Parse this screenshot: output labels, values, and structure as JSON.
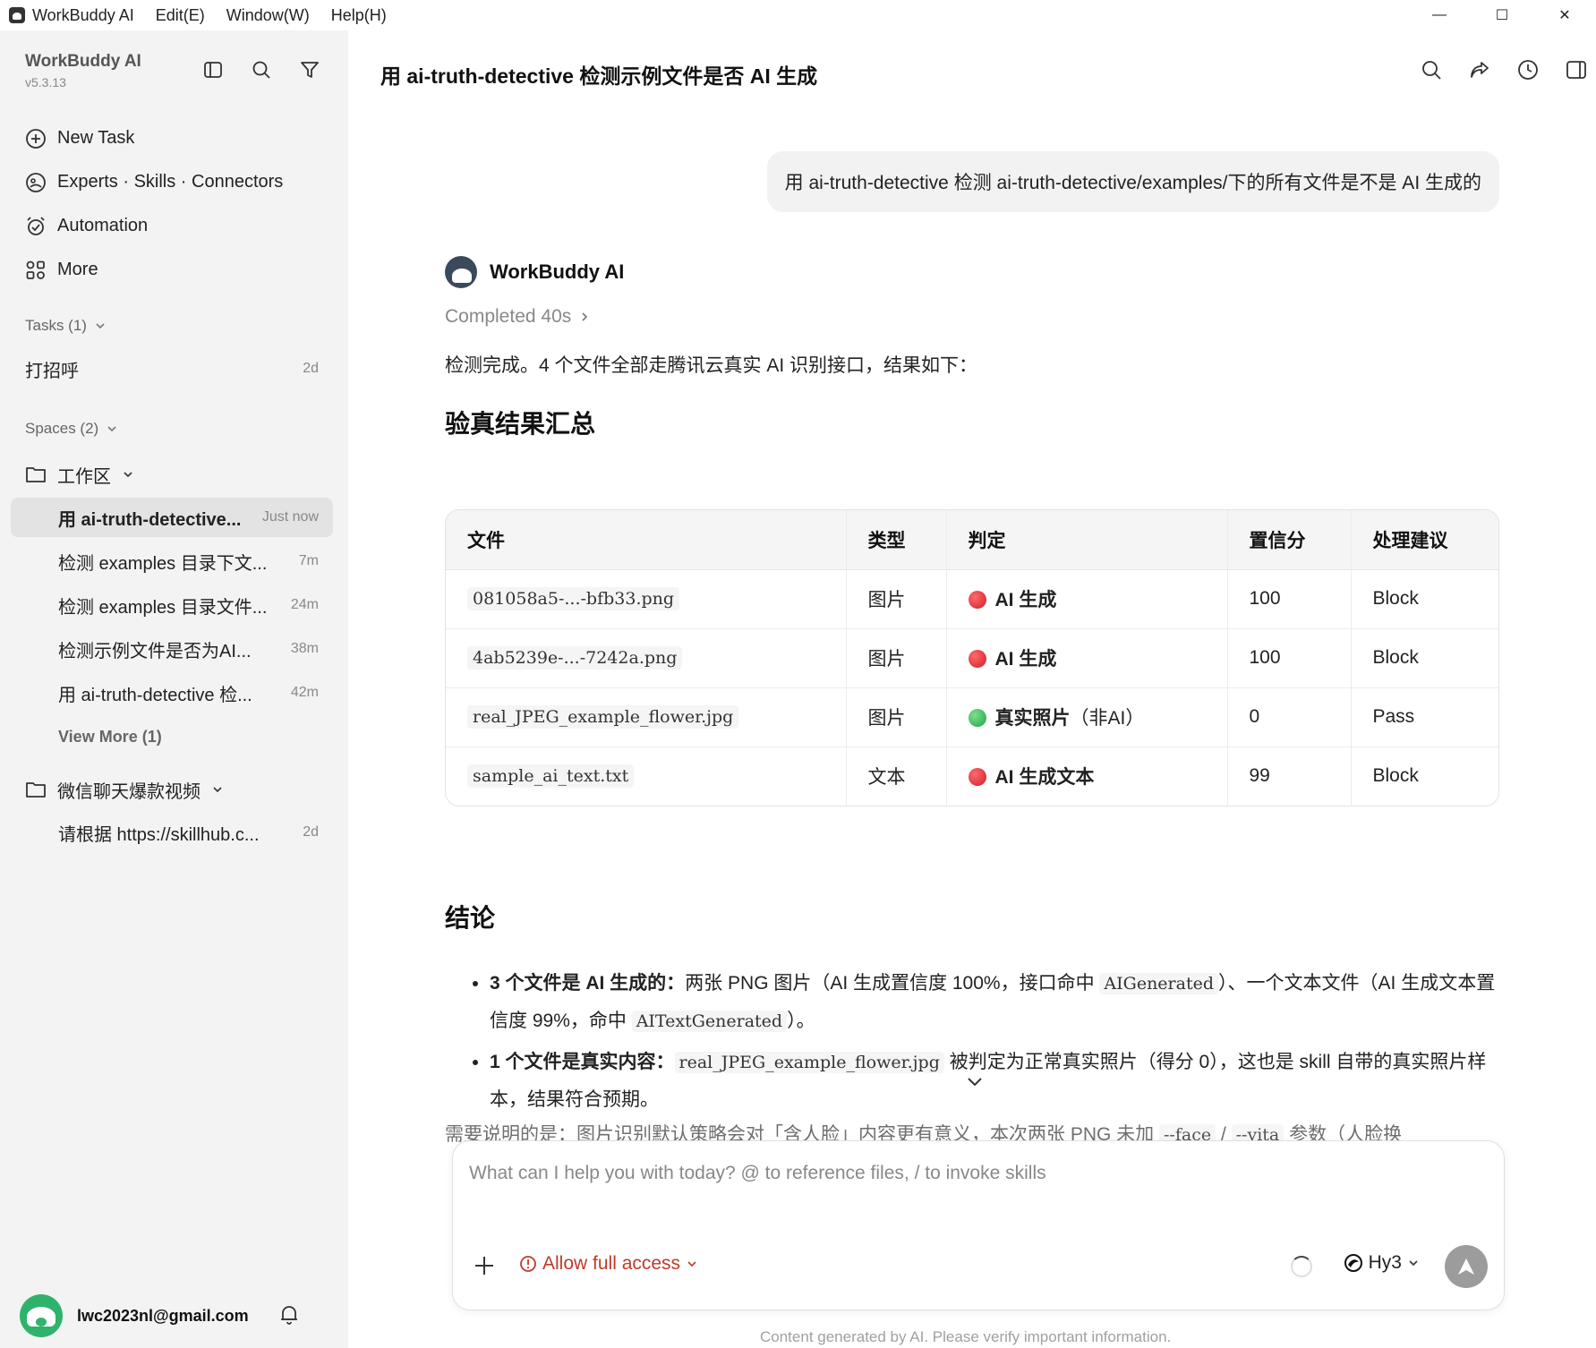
{
  "titlebar": {
    "app_name": "WorkBuddy AI",
    "menus": [
      "Edit(E)",
      "Window(W)",
      "Help(H)"
    ],
    "minimize": "—",
    "maximize": "☐",
    "close": "✕"
  },
  "sidebar": {
    "brand": "WorkBuddy AI",
    "version": "v5.3.13",
    "nav": [
      {
        "label": "New Task",
        "icon": "plus-circle-icon"
      },
      {
        "label": "Experts · Skills · Connectors",
        "icon": "experts-icon"
      },
      {
        "label": "Automation",
        "icon": "alarm-icon"
      },
      {
        "label": "More",
        "icon": "grid-icon"
      }
    ],
    "tasks_label": "Tasks (1)",
    "tasks": [
      {
        "title": "打招呼",
        "time": "2d"
      }
    ],
    "spaces_label": "Spaces (2)",
    "workspace1": {
      "name": "工作区",
      "items": [
        {
          "title": "用 ai-truth-detective...",
          "time": "Just now"
        },
        {
          "title": "检测 examples 目录下文...",
          "time": "7m"
        },
        {
          "title": "检测 examples 目录文件...",
          "time": "24m"
        },
        {
          "title": "检测示例文件是否为AI...",
          "time": "38m"
        },
        {
          "title": "用 ai-truth-detective 检...",
          "time": "42m"
        }
      ],
      "view_more": "View More (1)"
    },
    "workspace2": {
      "name": "微信聊天爆款视频",
      "items": [
        {
          "title": "请根据 https://skillhub.c...",
          "time": "2d"
        }
      ]
    },
    "user_email": "lwc2023nl@gmail.com"
  },
  "main": {
    "title": "用 ai-truth-detective 检测示例文件是否 AI 生成",
    "user_message": "用 ai-truth-detective 检测 ai-truth-detective/examples/下的所有文件是不是 AI 生成的",
    "bot_name": "WorkBuddy AI",
    "completed": "Completed 40s",
    "intro": "检测完成。4 个文件全部走腾讯云真实 AI 识别接口，结果如下：",
    "summary_heading": "验真结果汇总",
    "table": {
      "headers": [
        "文件",
        "类型",
        "判定",
        "置信分",
        "处理建议"
      ],
      "rows": [
        {
          "file": "081058a5-...-bfb33.png",
          "type": "图片",
          "verdict": "AI 生成",
          "verdict_extra": "",
          "status": "red",
          "score": "100",
          "action": "Block"
        },
        {
          "file": "4ab5239e-...-7242a.png",
          "type": "图片",
          "verdict": "AI 生成",
          "verdict_extra": "",
          "status": "red",
          "score": "100",
          "action": "Block"
        },
        {
          "file": "real_JPEG_example_flower.jpg",
          "type": "图片",
          "verdict": "真实照片",
          "verdict_extra": "（非AI）",
          "status": "green",
          "score": "0",
          "action": "Pass"
        },
        {
          "file": "sample_ai_text.txt",
          "type": "文本",
          "verdict": "AI 生成文本",
          "verdict_extra": "",
          "status": "red",
          "score": "99",
          "action": "Block"
        }
      ]
    },
    "conclusion_heading": "结论",
    "bullet1": {
      "bold": "3 个文件是 AI 生成的：",
      "text1": "两张 PNG 图片（AI 生成置信度 100%，接口命中 ",
      "code1": "AIGenerated",
      "text2": "）、一个文本文件（AI 生成文本置信度 99%，命中 ",
      "code2": "AITextGenerated",
      "text3": "）。"
    },
    "bullet2": {
      "bold": "1 个文件是真实内容：",
      "code": "real_JPEG_example_flower.jpg",
      "text": " 被判定为正常真实照片（得分 0），这也是 skill 自带的真实照片样本，结果符合预期。"
    },
    "note": {
      "text1": "需要说明的是：图片识别默认策略会对「含人脸」内容更有意义，本次两张 PNG 未加 ",
      "code1": "--face",
      "sep": " / ",
      "code2": "--vita",
      "text2": " 参数（人脸换"
    },
    "composer": {
      "placeholder": "What can I help you with today? @ to reference files, / to invoke skills",
      "access_label": "Allow full access",
      "model": "Hy3"
    },
    "footer": "Content generated by AI. Please verify important information."
  },
  "colors": {
    "accent_red": "#d01b2a",
    "accent_green": "#1fa34a",
    "sidebar_bg": "#f3f3f3",
    "access_red": "#c0392b"
  }
}
